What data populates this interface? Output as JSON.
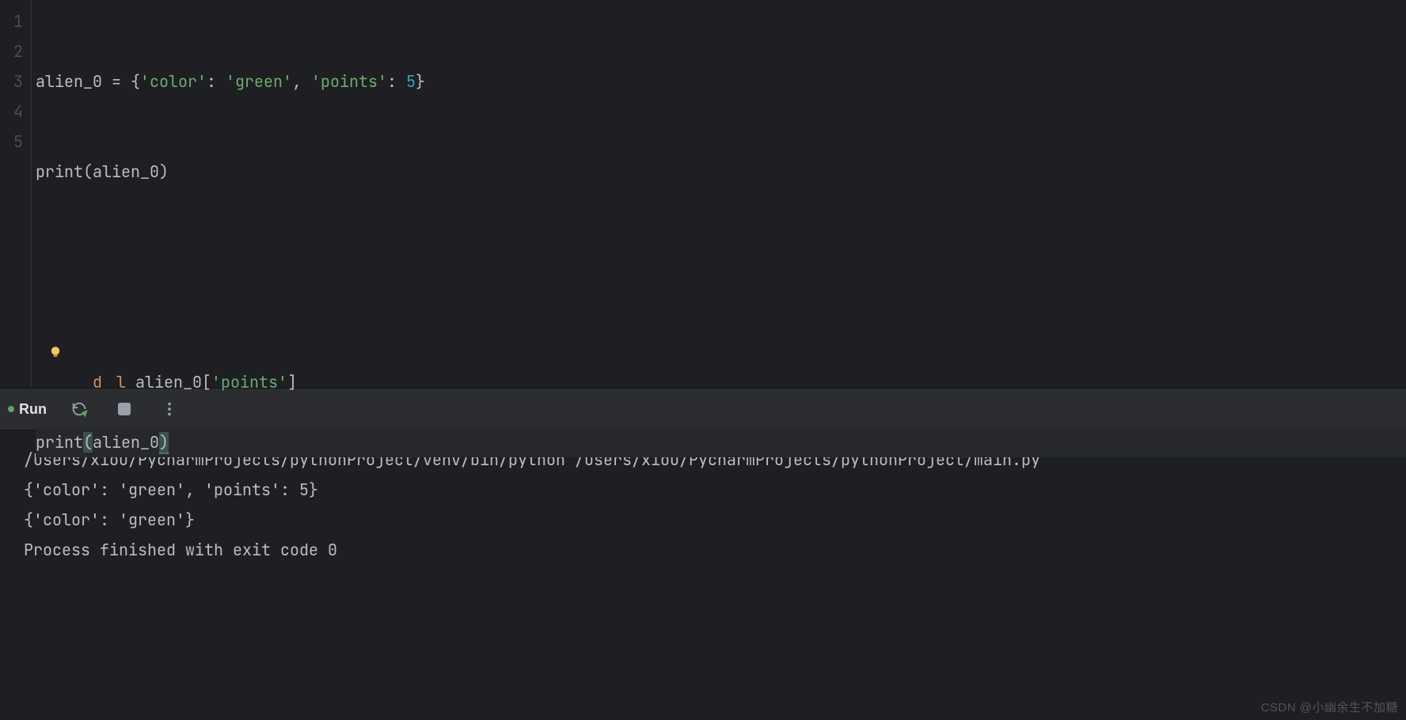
{
  "editor": {
    "line_numbers": [
      "1",
      "2",
      "3",
      "4",
      "5"
    ],
    "line1": {
      "var": "alien_0",
      "eq": " = ",
      "lb": "{",
      "k1": "'color'",
      "c1": ": ",
      "v1": "'green'",
      "cm": ", ",
      "k2": "'points'",
      "c2": ": ",
      "v2": "5",
      "rb": "}"
    },
    "line2": {
      "fn": "print",
      "lp": "(",
      "arg": "alien_0",
      "rp": ")"
    },
    "line4": {
      "kw_a": "d",
      "kw_b": "l",
      "sp": " ",
      "var": "alien_0",
      "lb": "[",
      "key": "'points'",
      "rb": "]"
    },
    "line5": {
      "fn": "print",
      "lp": "(",
      "arg": "alien_0",
      "rp": ")"
    }
  },
  "run": {
    "title": "Run",
    "console_lines": [
      "/Users/xiou/PycharmProjects/pythonProject/venv/bin/python /Users/xiou/PycharmProjects/pythonProject/main.py",
      "{'color': 'green', 'points': 5}",
      "{'color': 'green'}",
      "",
      "Process finished with exit code 0"
    ]
  },
  "watermark": "CSDN @小幽余生不加糖"
}
